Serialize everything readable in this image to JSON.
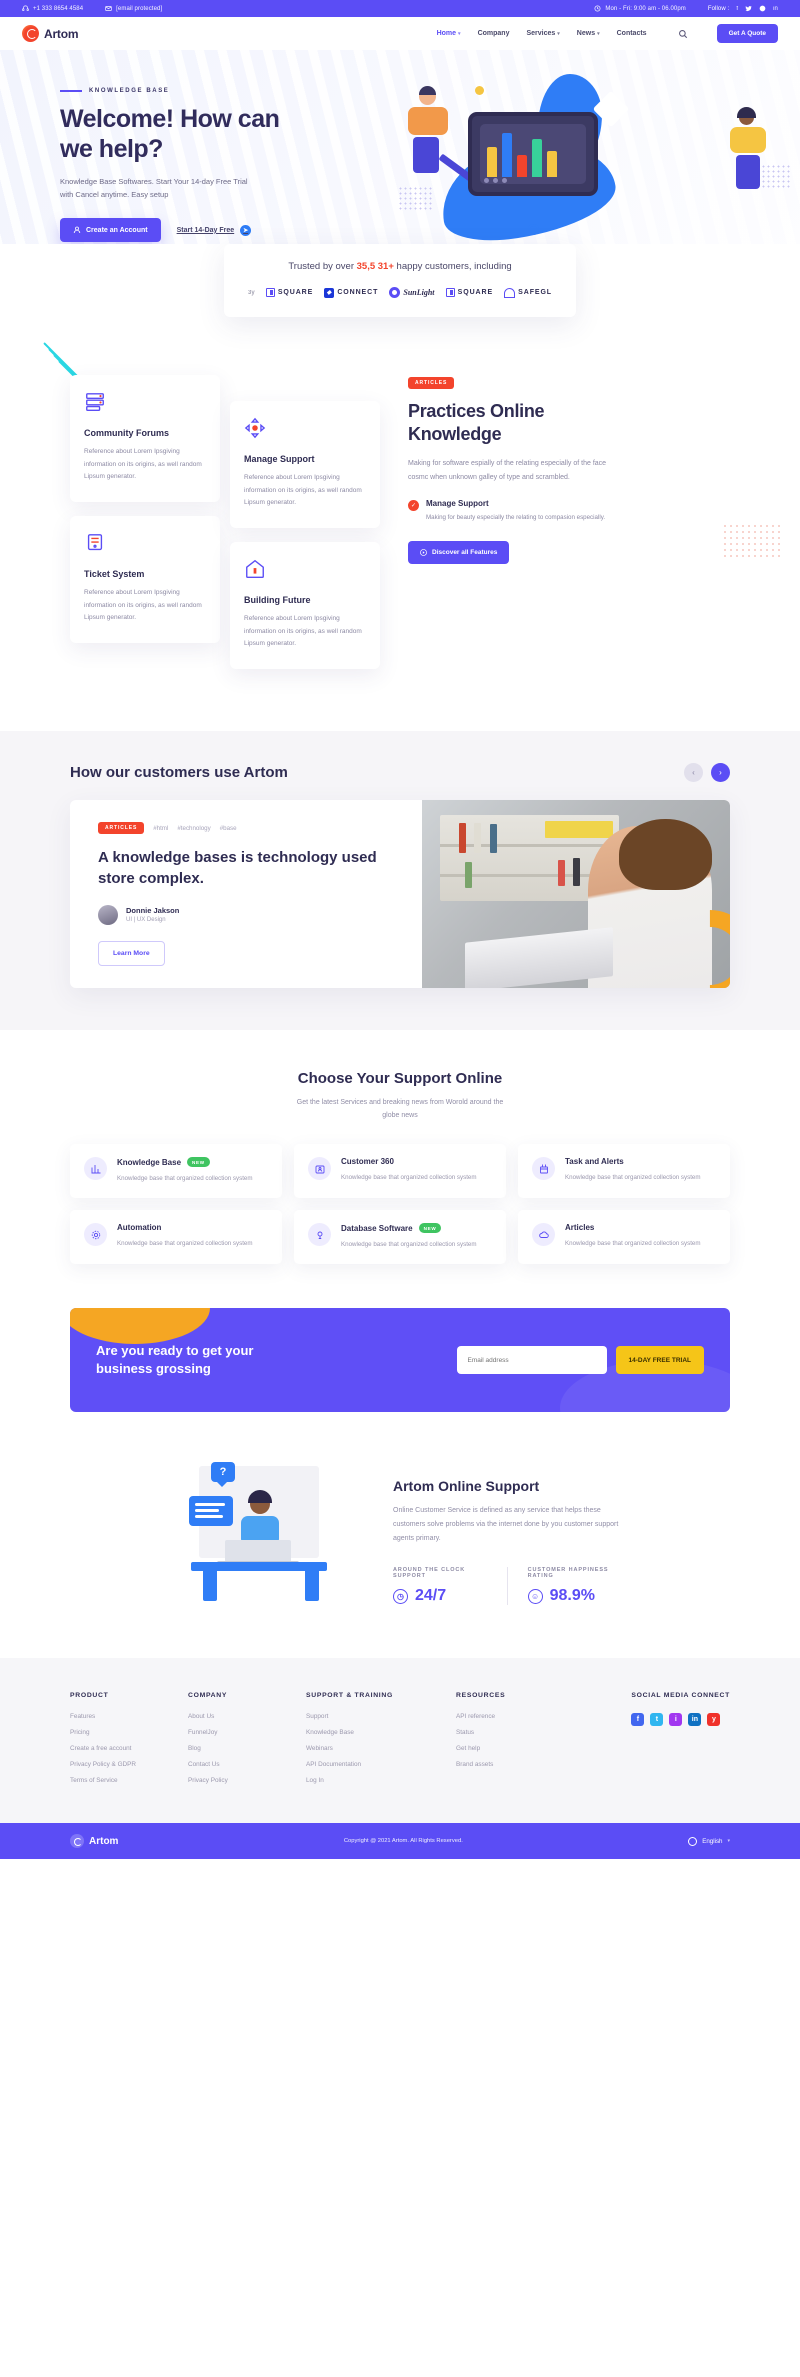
{
  "topbar": {
    "phone": "+1 333 8654 4584",
    "email": "[email protected]",
    "hours": "Mon - Fri: 9:00 am - 06.00pm",
    "follow_label": "Follow :",
    "socials": [
      "facebook-icon",
      "twitter-icon",
      "instagram-icon",
      "linkedin-icon"
    ],
    "bg": "#5b4df5"
  },
  "header": {
    "brand": "Artom",
    "nav": [
      {
        "label": "Home",
        "caret": true,
        "active": true
      },
      {
        "label": "Company",
        "caret": false,
        "active": false
      },
      {
        "label": "Services",
        "caret": true,
        "active": false
      },
      {
        "label": "News",
        "caret": true,
        "active": false
      },
      {
        "label": "Contacts",
        "caret": false,
        "active": false
      }
    ],
    "search_icon": "search-icon",
    "quote_button": "Get A Quote"
  },
  "hero": {
    "eyebrow": "KNOWLEDGE BASE",
    "title": "Welcome! How can we help?",
    "paragraph": "Knowledge Base Softwares. Start Your 14-day Free Trial with Cancel anytime. Easy setup",
    "primary_button": "Create an Account",
    "secondary_link": "Start 14-Day Free"
  },
  "trusted": {
    "prefix": "Trusted by over ",
    "highlight": "35,5 31+",
    "suffix": " happy customers, including",
    "logos": [
      "3y",
      "SQUARE",
      "CONNECT",
      "SunLight",
      "SQUARE",
      "SAFEGL"
    ]
  },
  "features": {
    "cards": [
      {
        "icon": "server-stack-icon",
        "title": "Community Forums",
        "text": "Reference about Lorem Ipsgiving information on its origins, as well random Lipsum generator."
      },
      {
        "icon": "move-arrows-icon",
        "title": "Manage Support",
        "text": "Reference about Lorem Ipsgiving information on its origins, as well random Lipsum generator."
      },
      {
        "icon": "ticket-icon",
        "title": "Ticket System",
        "text": "Reference about Lorem Ipsgiving information on its origins, as well random Lipsum generator."
      },
      {
        "icon": "home-building-icon",
        "title": "Building Future",
        "text": "Reference about Lorem Ipsgiving information on its origins, as well random Lipsum generator."
      }
    ],
    "badge": "ARTICLES",
    "title": "Practices Online Knowledge",
    "paragraph": "Making for software espially of the relating especially of the face cosmc when unknown galley of type and scrambled.",
    "check_title": "Manage Support",
    "check_text": "Making for beauty especially the relating to compasion especially.",
    "button": "Discover all Features"
  },
  "customers": {
    "heading": "How our customers use Artom",
    "prev_icon": "chevron-left-icon",
    "next_icon": "chevron-right-icon",
    "badge": "ARTICLES",
    "tags": [
      "#html",
      "#technology",
      "#base"
    ],
    "quote": "A knowledge bases is technology used store complex.",
    "author_name": "Donnie Jakson",
    "author_role": "UI | UX Design",
    "button": "Learn More"
  },
  "support": {
    "heading": "Choose Your Support Online",
    "subheading": "Get the latest Services and breaking news from Worold around the globe news",
    "cards": [
      {
        "icon": "chart-bar-icon",
        "title": "Knowledge Base",
        "new": "NEW",
        "text": "Knowledge base that organized collection system"
      },
      {
        "icon": "customer-id-icon",
        "title": "Customer 360",
        "new": "",
        "text": "Knowledge base that organized collection system"
      },
      {
        "icon": "tasks-alerts-icon",
        "title": "Task and Alerts",
        "new": "",
        "text": "Knowledge base that organized collection system"
      },
      {
        "icon": "gear-icon",
        "title": "Automation",
        "new": "",
        "text": "Knowledge base that organized collection system"
      },
      {
        "icon": "database-icon",
        "title": "Database Software",
        "new": "NEW",
        "text": "Knowledge base that organized collection system"
      },
      {
        "icon": "cloud-articles-icon",
        "title": "Articles",
        "new": "",
        "text": "Knowledge base that organized collection system"
      }
    ]
  },
  "cta": {
    "heading": "Are you ready to get your business grossing",
    "input_placeholder": "Email address",
    "input_value": "",
    "button": "14-DAY FREE TRIAL"
  },
  "online": {
    "title": "Artom Online Support",
    "paragraph": "Online Customer Service is defined as any service that helps these customers solve problems via the internet done by you customer support agents primary.",
    "stats": [
      {
        "label": "AROUND THE CLOCK SUPPORT",
        "value": "24/7",
        "icon": "clock-icon"
      },
      {
        "label": "CUSTOMER HAPPINESS RATING",
        "value": "98.9%",
        "icon": "smiley-icon"
      }
    ]
  },
  "footer": {
    "columns": [
      {
        "heading": "PRODUCT",
        "links": [
          "Features",
          "Pricing",
          "Create a free account",
          "Privacy Policy & GDPR",
          "Terms of Service"
        ]
      },
      {
        "heading": "COMPANY",
        "links": [
          "About Us",
          "FunnelJoy",
          "Blog",
          "Contact Us",
          "Privacy Policy"
        ]
      },
      {
        "heading": "SUPPORT & TRAINING",
        "links": [
          "Support",
          "Knowledge Base",
          "Webinars",
          "API Documentation",
          "Log In"
        ]
      },
      {
        "heading": "RESOURCES",
        "links": [
          "API reference",
          "Status",
          "Get help",
          "Brand assets"
        ]
      }
    ],
    "social_heading": "SOCIAL MEDIA CONNECT",
    "socials": [
      {
        "name": "facebook-icon",
        "glyph": "f",
        "color": "#4267ef"
      },
      {
        "name": "twitter-icon",
        "glyph": "t",
        "color": "#30b6f0"
      },
      {
        "name": "instagram-icon",
        "glyph": "i",
        "color": "#a237f0"
      },
      {
        "name": "linkedin-icon",
        "glyph": "in",
        "color": "#1071c2"
      },
      {
        "name": "youtube-icon",
        "glyph": "y",
        "color": "#f0312b"
      }
    ],
    "brand": "Artom",
    "copyright": "Copyright @ 2021 Artom. All Rights Reserved.",
    "language": "English",
    "language_icon": "globe-icon"
  },
  "colors": {
    "primary": "#5b4df5",
    "accent_red": "#f3442c",
    "accent_yellow": "#f5c518",
    "blue": "#2f7df6",
    "green": "#3fc461"
  }
}
